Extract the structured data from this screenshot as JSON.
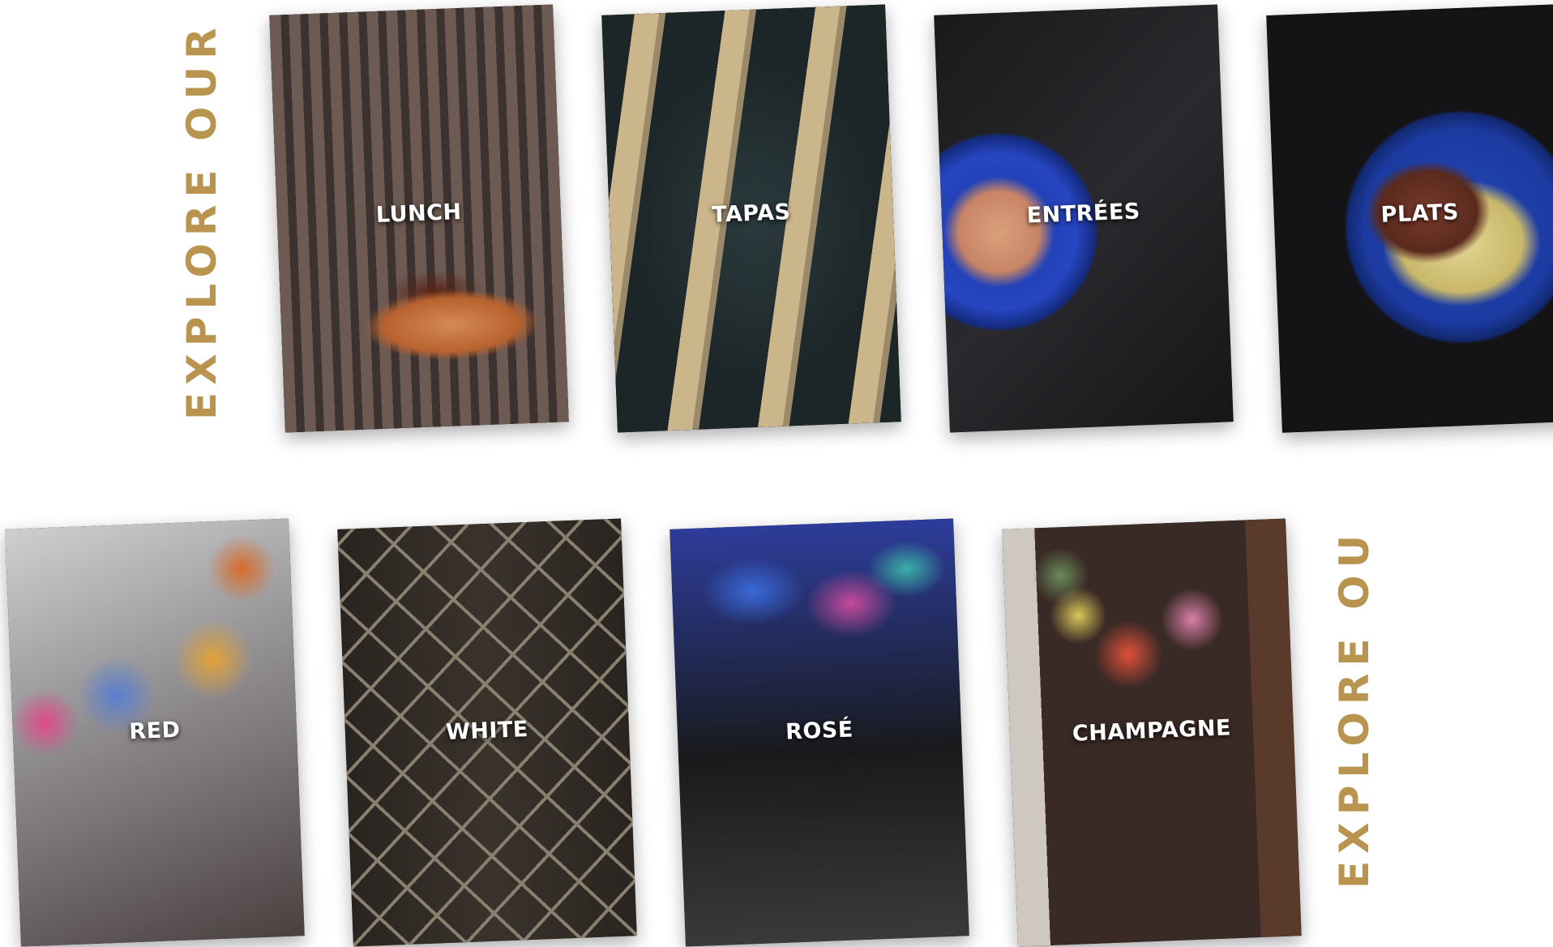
{
  "sections": {
    "cuisine_title": "EXPLORE OUR CUISINE",
    "wine_title": "EXPLORE OU"
  },
  "cuisine_cards": [
    {
      "label": "LUNCH"
    },
    {
      "label": "TAPAS"
    },
    {
      "label": "ENTRÉES"
    },
    {
      "label": "PLATS"
    }
  ],
  "wine_cards": [
    {
      "label": "RED"
    },
    {
      "label": "WHITE"
    },
    {
      "label": "ROSÉ"
    },
    {
      "label": "CHAMPAGNE"
    }
  ],
  "colors": {
    "accent_gold": "#b8944f",
    "background": "#ffffff",
    "label_text": "#ffffff"
  }
}
